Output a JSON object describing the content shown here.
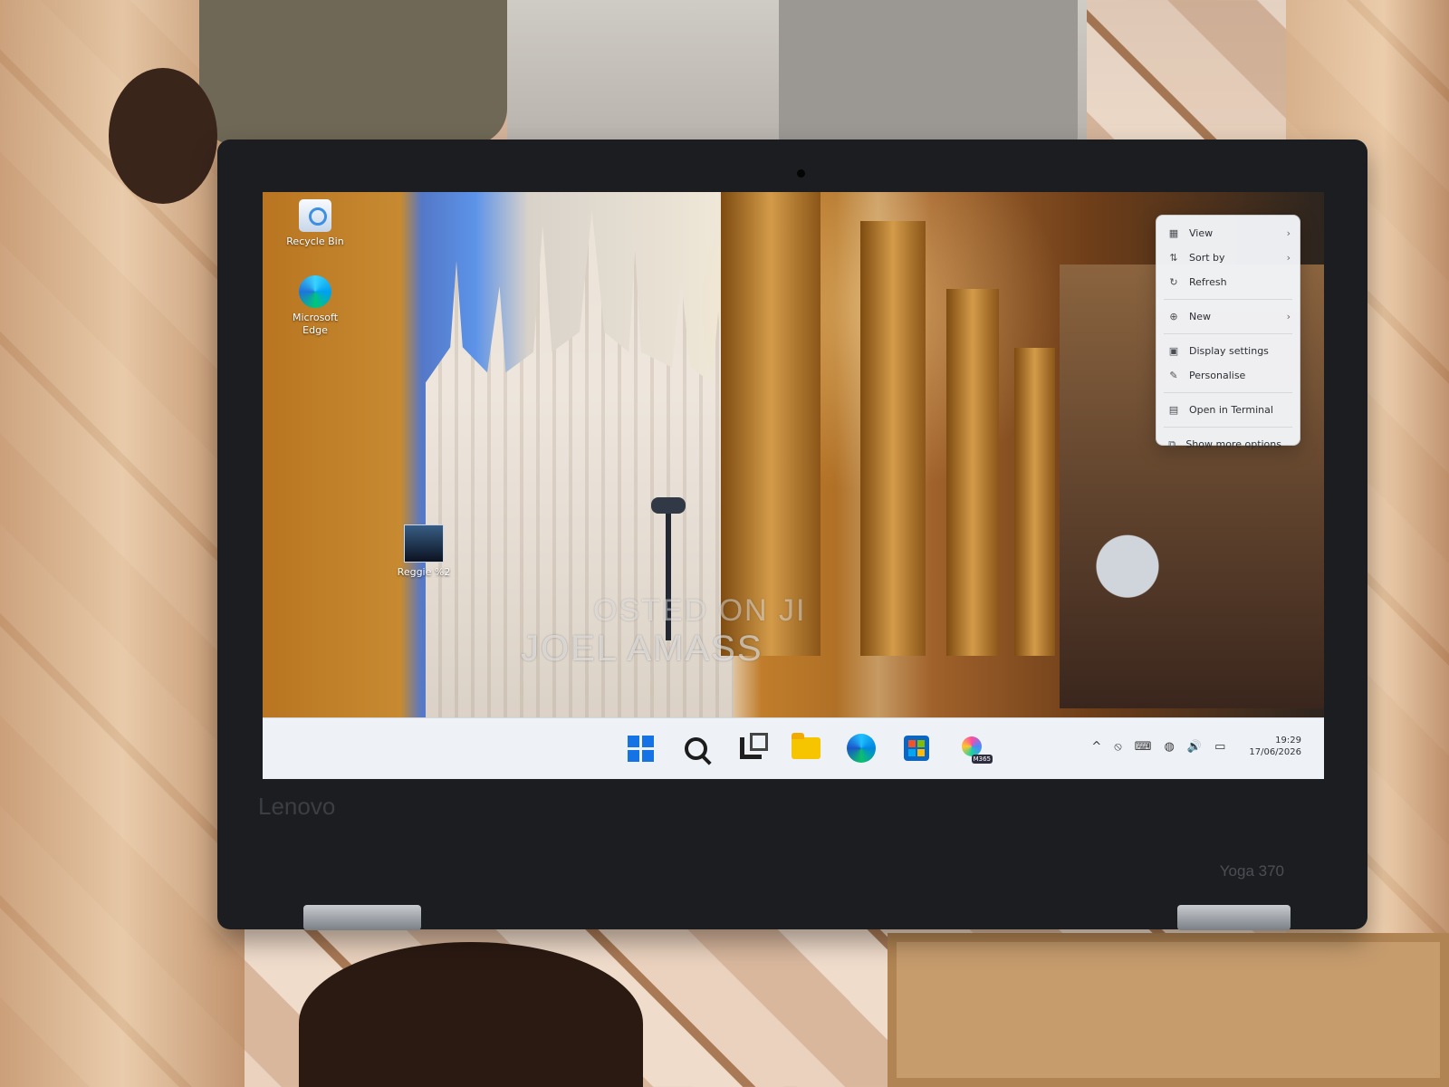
{
  "scene": {
    "brand_text": "Lenovo",
    "model_text": "Yoga 370",
    "watermark": {
      "line1": "OSTED ON JI",
      "line2": "JOEL AMASS"
    }
  },
  "desktop": {
    "icons": [
      {
        "label": "Recycle Bin",
        "icon": "recycle-bin-icon"
      },
      {
        "label": "Microsoft\nEdge",
        "icon": "edge-icon"
      },
      {
        "label": "Reggie %2",
        "icon": "image-file-icon"
      }
    ]
  },
  "context_menu": {
    "items": [
      {
        "label": "View",
        "icon": "view-icon",
        "chevron": "›"
      },
      {
        "label": "Sort by",
        "icon": "sort-icon",
        "chevron": "›"
      },
      {
        "label": "Refresh",
        "icon": "refresh-icon",
        "chevron": ""
      },
      {
        "label": "New",
        "icon": "new-icon",
        "chevron": "›"
      },
      {
        "label": "Display settings",
        "icon": "display-icon",
        "chevron": ""
      },
      {
        "label": "Personalise",
        "icon": "personalise-icon",
        "chevron": ""
      },
      {
        "label": "Open in Terminal",
        "icon": "terminal-icon",
        "chevron": ""
      },
      {
        "label": "Show more options",
        "icon": "more-options-icon",
        "chevron": ""
      }
    ]
  },
  "taskbar": {
    "apps": [
      {
        "name": "Start",
        "icon": "windows-icon"
      },
      {
        "name": "Search",
        "icon": "search-icon"
      },
      {
        "name": "Task View",
        "icon": "task-view-icon"
      },
      {
        "name": "File Explorer",
        "icon": "folder-icon"
      },
      {
        "name": "Microsoft Edge",
        "icon": "edge-icon"
      },
      {
        "name": "Microsoft Store",
        "icon": "store-icon"
      },
      {
        "name": "Microsoft 365",
        "icon": "m365-icon",
        "badge": "M365"
      }
    ],
    "tray": {
      "overflow": "^",
      "notify": "⦸",
      "keyboard": "⌨",
      "network": "◍",
      "volume": "🔊",
      "battery": "▭",
      "time": "19:29",
      "date": "17/06/2026"
    }
  }
}
